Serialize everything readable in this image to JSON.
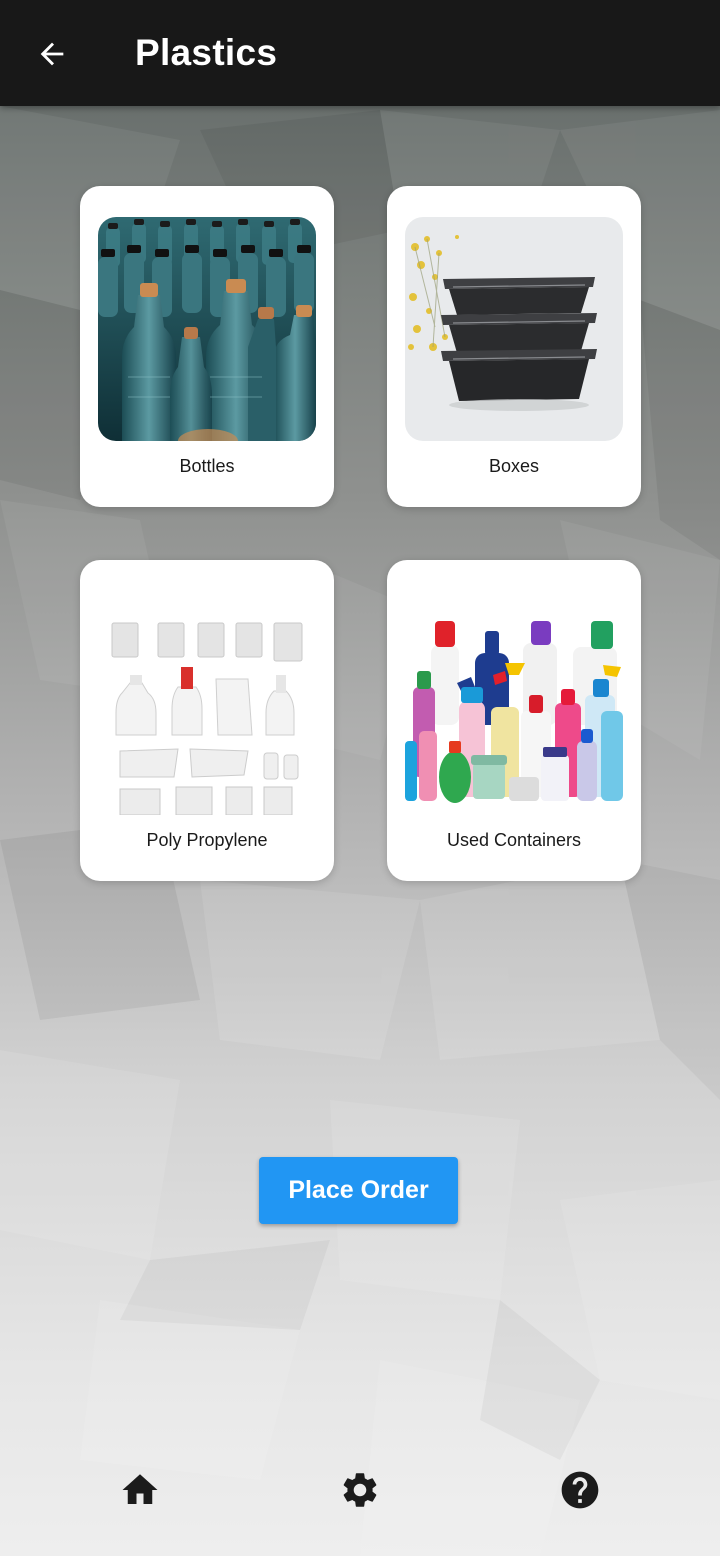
{
  "appbar": {
    "title": "Plastics",
    "back_icon": "arrow-back-icon"
  },
  "categories": [
    {
      "label": "Bottles",
      "image": "plastic-bottles-photo"
    },
    {
      "label": "Boxes",
      "image": "black-plastic-boxes-photo"
    },
    {
      "label": "Poly Propylene",
      "image": "white-packaging-mockups-photo"
    },
    {
      "label": "Used Containers",
      "image": "colorful-detergent-bottles-photo"
    }
  ],
  "actions": {
    "place_order_label": "Place Order",
    "color": "#2196f3"
  },
  "bottom_nav": {
    "items": [
      {
        "icon": "home-icon"
      },
      {
        "icon": "settings-gear-icon"
      },
      {
        "icon": "help-icon"
      }
    ]
  },
  "colors": {
    "appbar": "#181818",
    "card": "#ffffff"
  }
}
